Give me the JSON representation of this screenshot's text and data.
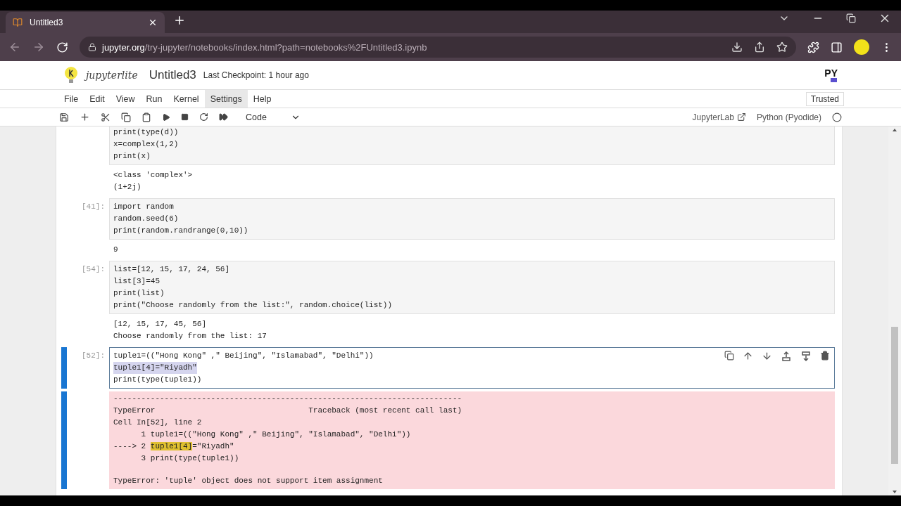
{
  "browser": {
    "tabs": [
      {
        "title": "Untitled3",
        "selected": true
      }
    ],
    "url_domain": "jupyter.org",
    "url_path": "/try-jupyter/notebooks/index.html?path=notebooks%2FUntitled3.ipynb"
  },
  "header": {
    "logo_text": "jupyterlite",
    "title": "Untitled3",
    "checkpoint": "Last Checkpoint: 1 hour ago",
    "kernel_logo": "PY"
  },
  "menu": {
    "items": [
      {
        "label": "File",
        "selected": false
      },
      {
        "label": "Edit",
        "selected": false
      },
      {
        "label": "View",
        "selected": false
      },
      {
        "label": "Run",
        "selected": false
      },
      {
        "label": "Kernel",
        "selected": false
      },
      {
        "label": "Settings",
        "selected": true
      },
      {
        "label": "Help",
        "selected": false
      }
    ],
    "trusted": "Trusted"
  },
  "toolbar": {
    "cell_type": "Code",
    "jupyterlab_link": "JupyterLab",
    "kernel": "Python (Pyodide)",
    "kernel_busy": false
  },
  "cells": [
    {
      "active": false,
      "lines": [
        {
          "text": "print(type(d))",
          "selected": false
        },
        {
          "text": "x=complex(1,2)",
          "selected": false
        },
        {
          "text": "print(x)",
          "selected": false
        }
      ],
      "output": {
        "kind": "stream",
        "lines": [
          "<class 'complex'>",
          "(1+2j)"
        ]
      }
    },
    {
      "prompt": "[41]:",
      "active": false,
      "lines": [
        {
          "text": "import random",
          "selected": false
        },
        {
          "text": "random.seed(6)",
          "selected": false
        },
        {
          "text": "print(random.randrange(0,10))",
          "selected": false
        }
      ],
      "output": {
        "kind": "stream",
        "lines": [
          "9"
        ]
      }
    },
    {
      "prompt": "[54]:",
      "active": false,
      "lines": [
        {
          "text": "list=[12, 15, 17, 24, 56]",
          "selected": false
        },
        {
          "text": "list[3]=45",
          "selected": false
        },
        {
          "text": "print(list)",
          "selected": false
        },
        {
          "text": "print(\"Choose randomly from the list:\", random.choice(list))",
          "selected": false
        }
      ],
      "output": {
        "kind": "stream",
        "lines": [
          "[12, 15, 17, 45, 56]",
          "Choose randomly from the list: 17"
        ]
      }
    },
    {
      "prompt": "[52]:",
      "active": true,
      "lines": [
        {
          "text": "tuple1=((\"Hong Kong\" ,\" Beijing\", \"Islamabad\", \"Delhi\"))",
          "selected": false
        },
        {
          "text": "tuple1[4]=\"Riyadh\"",
          "selected": true
        },
        {
          "text": "print(type(tuple1))",
          "selected": false
        }
      ],
      "output": {
        "kind": "error",
        "lines": [
          {
            "parts": [
              {
                "text": "---------------------------------------------------------------------------",
                "highlight": false
              }
            ]
          },
          {
            "parts": [
              {
                "text": "TypeError                                 Traceback (most recent call last)",
                "highlight": false
              }
            ]
          },
          {
            "parts": [
              {
                "text": "Cell In[52], line 2",
                "highlight": false
              }
            ]
          },
          {
            "parts": [
              {
                "text": "      1 tuple1=((\"Hong Kong\" ,\" Beijing\", \"Islamabad\", \"Delhi\"))",
                "highlight": false
              }
            ]
          },
          {
            "parts": [
              {
                "text": "----> 2 ",
                "highlight": false
              },
              {
                "text": "tuple1[4]",
                "highlight": true
              },
              {
                "text": "=\"Riyadh\"",
                "highlight": false
              }
            ]
          },
          {
            "parts": [
              {
                "text": "      3 print(type(tuple1))",
                "highlight": false
              }
            ]
          }
        ],
        "message": "TypeError: 'tuple' object does not support item assignment"
      }
    }
  ]
}
